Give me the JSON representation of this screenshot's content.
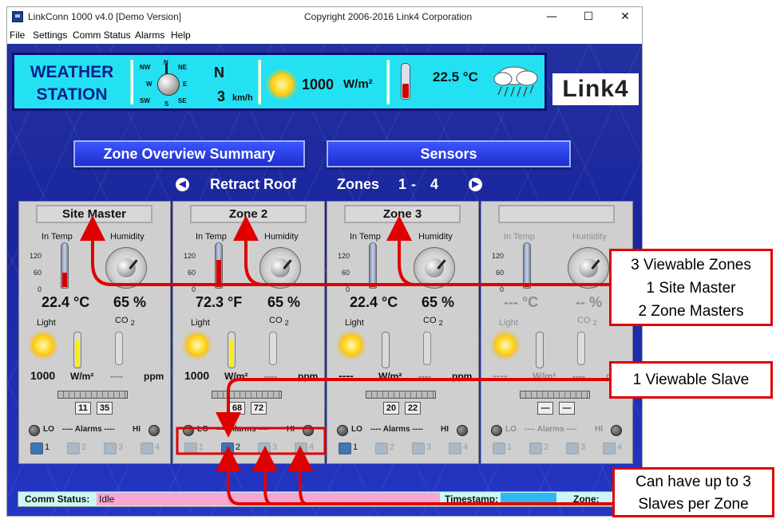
{
  "window": {
    "title": "LinkConn 1000 v4.0 [Demo Version]",
    "copyright": "Copyright 2006-2016 Link4 Corporation",
    "controls": {
      "minimize": "—",
      "maximize": "☐",
      "close": "✕"
    }
  },
  "menu": [
    "File",
    "Settings",
    "Comm Status",
    "Alarms",
    "Help"
  ],
  "weather": {
    "title_line1": "WEATHER",
    "title_line2": "STATION",
    "compass": {
      "nw": "NW",
      "n": "N",
      "ne": "NE",
      "w": "W",
      "e": "E",
      "sw": "SW",
      "s": "S",
      "se": "SE"
    },
    "wind_dir": "N",
    "wind_speed": "3",
    "wind_unit": "km/h",
    "solar": "1000",
    "solar_unit": "W/m²",
    "temp": "22.5 °C"
  },
  "logo": "Link4",
  "buttons": {
    "overview": "Zone Overview Summary",
    "sensors": "Sensors"
  },
  "nav": {
    "mode": "Retract Roof",
    "zones": "Zones",
    "zone_start": "1",
    "dash": "-",
    "zone_end": "4"
  },
  "zone_labels": {
    "in_temp": "In Temp",
    "humidity": "Humidity",
    "light": "Light",
    "co2": "CO",
    "co2_sub": "2",
    "scale": [
      "120",
      "60",
      "0"
    ],
    "light_unit": "W/m²",
    "co2_unit": "ppm",
    "lo": "LO",
    "alarms": "---- Alarms ----",
    "hi": "HI",
    "slaves": [
      "1",
      "2",
      "3",
      "4"
    ]
  },
  "zones": [
    {
      "name": "Site Master",
      "temp": "22.4 °C",
      "humidity": "65 %",
      "light": "1000",
      "co2": "----",
      "slave_a": "11",
      "slave_b": "35",
      "temp_fill": 0.3,
      "light_fill": 0.85,
      "active_slave": 1
    },
    {
      "name": "Zone 2",
      "temp": "72.3 °F",
      "humidity": "65 %",
      "light": "1000",
      "co2": "----",
      "slave_a": "68",
      "slave_b": "72",
      "temp_fill": 0.6,
      "light_fill": 0.85,
      "active_slave": 2
    },
    {
      "name": "Zone 3",
      "temp": "22.4 °C",
      "humidity": "65 %",
      "light": "----",
      "co2": "----",
      "slave_a": "20",
      "slave_b": "22",
      "temp_fill": 0.0,
      "light_fill": 0.0,
      "active_slave": 1
    },
    {
      "name": "",
      "temp": "--- °C",
      "humidity": "-- %",
      "light": "----",
      "co2": "----",
      "slave_a": "—",
      "slave_b": "—",
      "temp_fill": 0.0,
      "light_fill": 0.0,
      "active_slave": 0
    }
  ],
  "status": {
    "comm_label": "Comm Status:",
    "comm_value": "Idle",
    "timestamp_label": "Timestamp:",
    "zone_label": "Zone:"
  },
  "callouts": {
    "viewable_zones": [
      "3 Viewable Zones",
      "1 Site Master",
      "2 Zone Masters"
    ],
    "viewable_slave": "1 Viewable Slave",
    "slaves_per_zone": [
      "Can have up to 3",
      "Slaves per Zone"
    ]
  },
  "colors": {
    "accent_red": "#e00000",
    "bg_blue": "#1d27a8",
    "weather_bg": "#23e1f2"
  }
}
